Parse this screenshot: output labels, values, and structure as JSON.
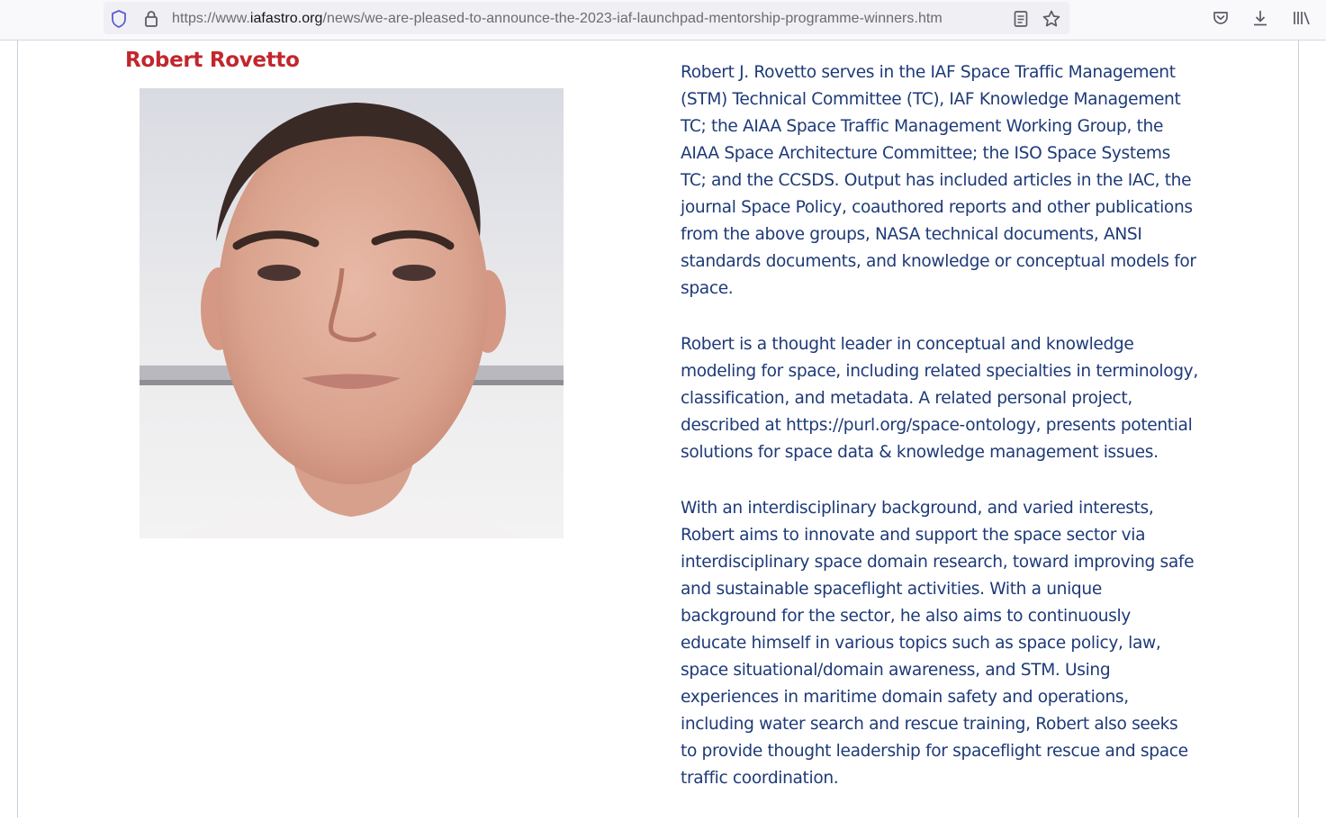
{
  "browser": {
    "url_scheme": "https://www.",
    "url_domain": "iafastro.org",
    "url_path": "/news/we-are-pleased-to-announce-the-2023-iaf-launchpad-mentorship-programme-winners.htm",
    "icons": [
      "shield-icon",
      "lock-icon",
      "reader-view-icon",
      "bookmark-star-icon",
      "pocket-icon",
      "download-icon",
      "library-icon"
    ]
  },
  "profile": {
    "name": "Robert Rovetto",
    "name_color": "#c1272d",
    "text_color": "#1e3a78",
    "bio": [
      "Robert J. Rovetto serves in the IAF Space Traffic Management (STM) Technical Committee (TC), IAF Knowledge Management TC; the AIAA Space Traffic Management Working Group, the AIAA Space Architecture Committee; the ISO Space Systems TC; and the CCSDS. Output has included articles in the IAC, the journal Space Policy, coauthored reports and other publications from the above groups, NASA technical documents, ANSI standards documents, and knowledge or conceptual models for space.",
      "Robert is a thought leader in conceptual and knowledge modeling for space, including related specialties in terminology, classification, and metadata. A related personal project, described at https://purl.org/space-ontology, presents potential solutions for space data & knowledge management issues.",
      "With an interdisciplinary background, and varied interests, Robert aims to innovate and support the space sector via interdisciplinary space domain research, toward improving safe and sustainable spaceflight activities. With a unique background for the sector, he also aims to continuously educate himself in various topics such as space policy, law, space situational/domain awareness, and STM. Using experiences in maritime domain safety and operations, including water search and rescue training, Robert also seeks to provide thought leadership for spaceflight rescue and space traffic coordination."
    ]
  }
}
